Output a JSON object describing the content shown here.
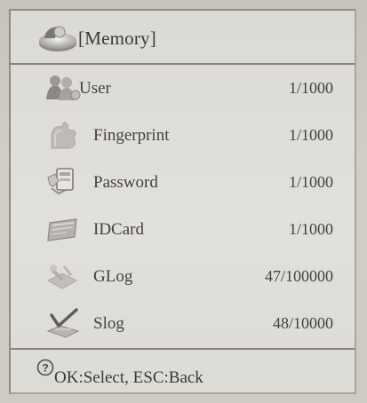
{
  "header": {
    "title": "[Memory]",
    "icon": "disk-icon"
  },
  "rows": [
    {
      "label": "User",
      "value": "1/1000",
      "icon": "users-icon"
    },
    {
      "label": "Fingerprint",
      "value": "1/1000",
      "icon": "fingerprint-icon"
    },
    {
      "label": "Password",
      "value": "1/1000",
      "icon": "password-icon"
    },
    {
      "label": "IDCard",
      "value": "1/1000",
      "icon": "id-card-icon"
    },
    {
      "label": "GLog",
      "value": "47/100000",
      "icon": "glog-icon"
    },
    {
      "label": "Slog",
      "value": "48/10000",
      "icon": "slog-icon"
    }
  ],
  "footer": {
    "hint": "OK:Select, ESC:Back",
    "icon": "help-icon"
  },
  "colors": {
    "screen_bg": "#e0deda",
    "separator": "#86827c",
    "text": "#3c3b3a"
  }
}
